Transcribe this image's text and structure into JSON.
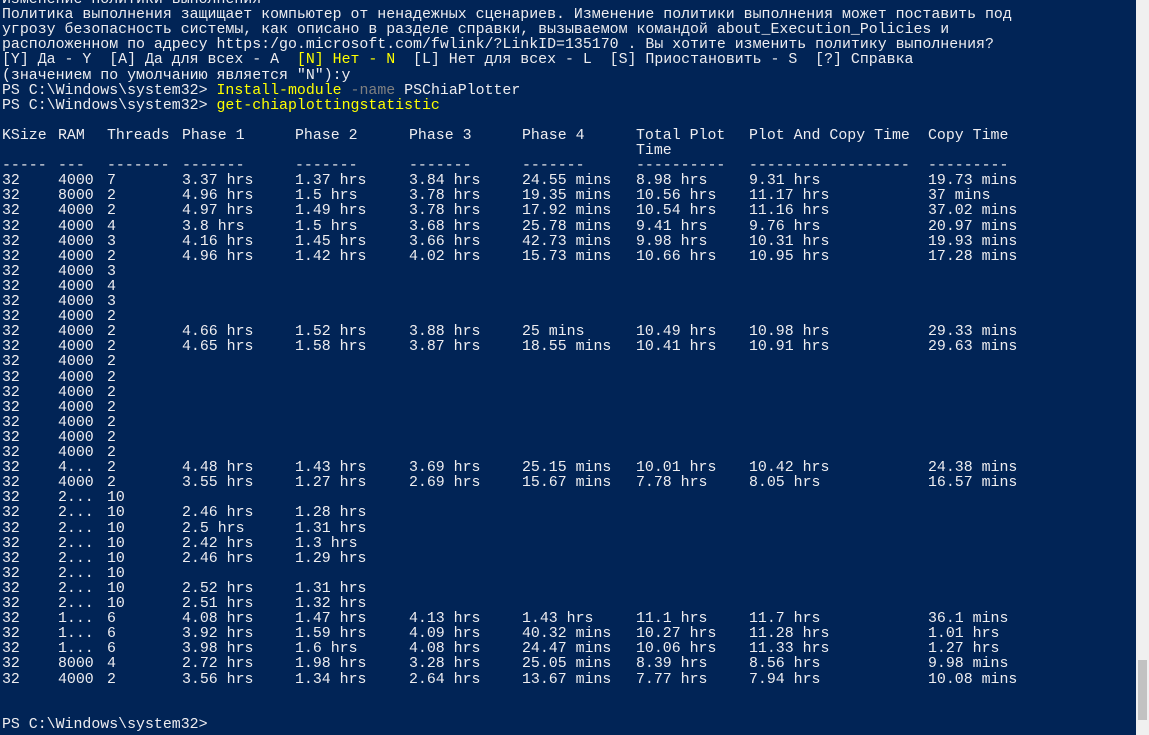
{
  "policy_prompt": {
    "lines": [
      "Изменение политики выполнения",
      "Политика выполнения защищает компьютер от ненадежных сценариев. Изменение политики выполнения может поставить под",
      "угрозу безопасность системы, как описано в разделе справки, вызываемом командой about_Execution_Policies и",
      "расположенном по адресу https:/go.microsoft.com/fwlink/?LinkID=135170 . Вы хотите изменить политику выполнения?"
    ],
    "choices_before": "[Y] Да - Y  [A] Да для всех - A  ",
    "choice_default": "[N] Нет - N",
    "choices_after": "  [L] Нет для всех - L  [S] Приостановить - S  [?] Справка",
    "default_line": "(значением по умолчанию является \"N\"):y"
  },
  "commands": [
    {
      "prompt": "PS C:\\Windows\\system32> ",
      "cmdlet": "Install-module",
      "param": " -name ",
      "arg": "PSChiaPlotter"
    },
    {
      "prompt": "PS C:\\Windows\\system32> ",
      "cmdlet": "get-chiaplottingstatistic",
      "param": "",
      "arg": ""
    }
  ],
  "table": {
    "headers": [
      "KSize",
      "RAM",
      "Threads",
      "Phase 1",
      "Phase 2",
      "Phase 3",
      "Phase 4",
      "Total Plot",
      "Plot And Copy Time",
      "Copy Time"
    ],
    "header_cont": "Time",
    "separators": [
      "-----",
      "---",
      "-------",
      "-------",
      "-------",
      "-------",
      "-------",
      "----------",
      "------------------",
      "---------"
    ],
    "rows": [
      [
        "32",
        "4000",
        "7",
        "3.37 hrs",
        "1.37 hrs",
        "3.84 hrs",
        "24.55 mins",
        "8.98 hrs",
        "9.31 hrs",
        "19.73 mins"
      ],
      [
        "32",
        "8000",
        "2",
        "4.96 hrs",
        "1.5 hrs",
        "3.78 hrs",
        "19.35 mins",
        "10.56 hrs",
        "11.17 hrs",
        "37 mins"
      ],
      [
        "32",
        "4000",
        "2",
        "4.97 hrs",
        "1.49 hrs",
        "3.78 hrs",
        "17.92 mins",
        "10.54 hrs",
        "11.16 hrs",
        "37.02 mins"
      ],
      [
        "32",
        "4000",
        "4",
        "3.8 hrs",
        "1.5 hrs",
        "3.68 hrs",
        "25.78 mins",
        "9.41 hrs",
        "9.76 hrs",
        "20.97 mins"
      ],
      [
        "32",
        "4000",
        "3",
        "4.16 hrs",
        "1.45 hrs",
        "3.66 hrs",
        "42.73 mins",
        "9.98 hrs",
        "10.31 hrs",
        "19.93 mins"
      ],
      [
        "32",
        "4000",
        "2",
        "4.96 hrs",
        "1.42 hrs",
        "4.02 hrs",
        "15.73 mins",
        "10.66 hrs",
        "10.95 hrs",
        "17.28 mins"
      ],
      [
        "32",
        "4000",
        "3",
        "",
        "",
        "",
        "",
        "",
        "",
        ""
      ],
      [
        "32",
        "4000",
        "4",
        "",
        "",
        "",
        "",
        "",
        "",
        ""
      ],
      [
        "32",
        "4000",
        "3",
        "",
        "",
        "",
        "",
        "",
        "",
        ""
      ],
      [
        "32",
        "4000",
        "2",
        "",
        "",
        "",
        "",
        "",
        "",
        ""
      ],
      [
        "32",
        "4000",
        "2",
        "4.66 hrs",
        "1.52 hrs",
        "3.88 hrs",
        "25 mins",
        "10.49 hrs",
        "10.98 hrs",
        "29.33 mins"
      ],
      [
        "32",
        "4000",
        "2",
        "4.65 hrs",
        "1.58 hrs",
        "3.87 hrs",
        "18.55 mins",
        "10.41 hrs",
        "10.91 hrs",
        "29.63 mins"
      ],
      [
        "32",
        "4000",
        "2",
        "",
        "",
        "",
        "",
        "",
        "",
        ""
      ],
      [
        "32",
        "4000",
        "2",
        "",
        "",
        "",
        "",
        "",
        "",
        ""
      ],
      [
        "32",
        "4000",
        "2",
        "",
        "",
        "",
        "",
        "",
        "",
        ""
      ],
      [
        "32",
        "4000",
        "2",
        "",
        "",
        "",
        "",
        "",
        "",
        ""
      ],
      [
        "32",
        "4000",
        "2",
        "",
        "",
        "",
        "",
        "",
        "",
        ""
      ],
      [
        "32",
        "4000",
        "2",
        "",
        "",
        "",
        "",
        "",
        "",
        ""
      ],
      [
        "32",
        "4000",
        "2",
        "",
        "",
        "",
        "",
        "",
        "",
        ""
      ],
      [
        "32",
        "4...",
        "2",
        "4.48 hrs",
        "1.43 hrs",
        "3.69 hrs",
        "25.15 mins",
        "10.01 hrs",
        "10.42 hrs",
        "24.38 mins"
      ],
      [
        "32",
        "4000",
        "2",
        "3.55 hrs",
        "1.27 hrs",
        "2.69 hrs",
        "15.67 mins",
        "7.78 hrs",
        "8.05 hrs",
        "16.57 mins"
      ],
      [
        "32",
        "2...",
        "10",
        "",
        "",
        "",
        "",
        "",
        "",
        ""
      ],
      [
        "32",
        "2...",
        "10",
        "2.46 hrs",
        "1.28 hrs",
        "",
        "",
        "",
        "",
        ""
      ],
      [
        "32",
        "2...",
        "10",
        "2.5 hrs",
        "1.31 hrs",
        "",
        "",
        "",
        "",
        ""
      ],
      [
        "32",
        "2...",
        "10",
        "2.42 hrs",
        "1.3 hrs",
        "",
        "",
        "",
        "",
        ""
      ],
      [
        "32",
        "2...",
        "10",
        "2.46 hrs",
        "1.29 hrs",
        "",
        "",
        "",
        "",
        ""
      ],
      [
        "32",
        "2...",
        "10",
        "",
        "",
        "",
        "",
        "",
        "",
        ""
      ],
      [
        "32",
        "2...",
        "10",
        "2.52 hrs",
        "1.31 hrs",
        "",
        "",
        "",
        "",
        ""
      ],
      [
        "32",
        "2...",
        "10",
        "2.51 hrs",
        "1.32 hrs",
        "",
        "",
        "",
        "",
        ""
      ],
      [
        "32",
        "1...",
        "6",
        "4.08 hrs",
        "1.47 hrs",
        "4.13 hrs",
        "1.43 hrs",
        "11.1 hrs",
        "11.7 hrs",
        "36.1 mins"
      ],
      [
        "32",
        "1...",
        "6",
        "3.92 hrs",
        "1.59 hrs",
        "4.09 hrs",
        "40.32 mins",
        "10.27 hrs",
        "11.28 hrs",
        "1.01 hrs"
      ],
      [
        "32",
        "1...",
        "6",
        "3.98 hrs",
        "1.6 hrs",
        "4.08 hrs",
        "24.47 mins",
        "10.06 hrs",
        "11.33 hrs",
        "1.27 hrs"
      ],
      [
        "32",
        "8000",
        "4",
        "2.72 hrs",
        "1.98 hrs",
        "3.28 hrs",
        "25.05 mins",
        "8.39 hrs",
        "8.56 hrs",
        "9.98 mins"
      ],
      [
        "32",
        "4000",
        "2",
        "3.56 hrs",
        "1.34 hrs",
        "2.64 hrs",
        "13.67 mins",
        "7.77 hrs",
        "7.94 hrs",
        "10.08 mins"
      ]
    ]
  },
  "final_prompt": "PS C:\\Windows\\system32> ",
  "colors": {
    "background": "#012456",
    "text": "#eeedf0",
    "cmdlet": "#ffff00",
    "parameter": "#808080"
  }
}
